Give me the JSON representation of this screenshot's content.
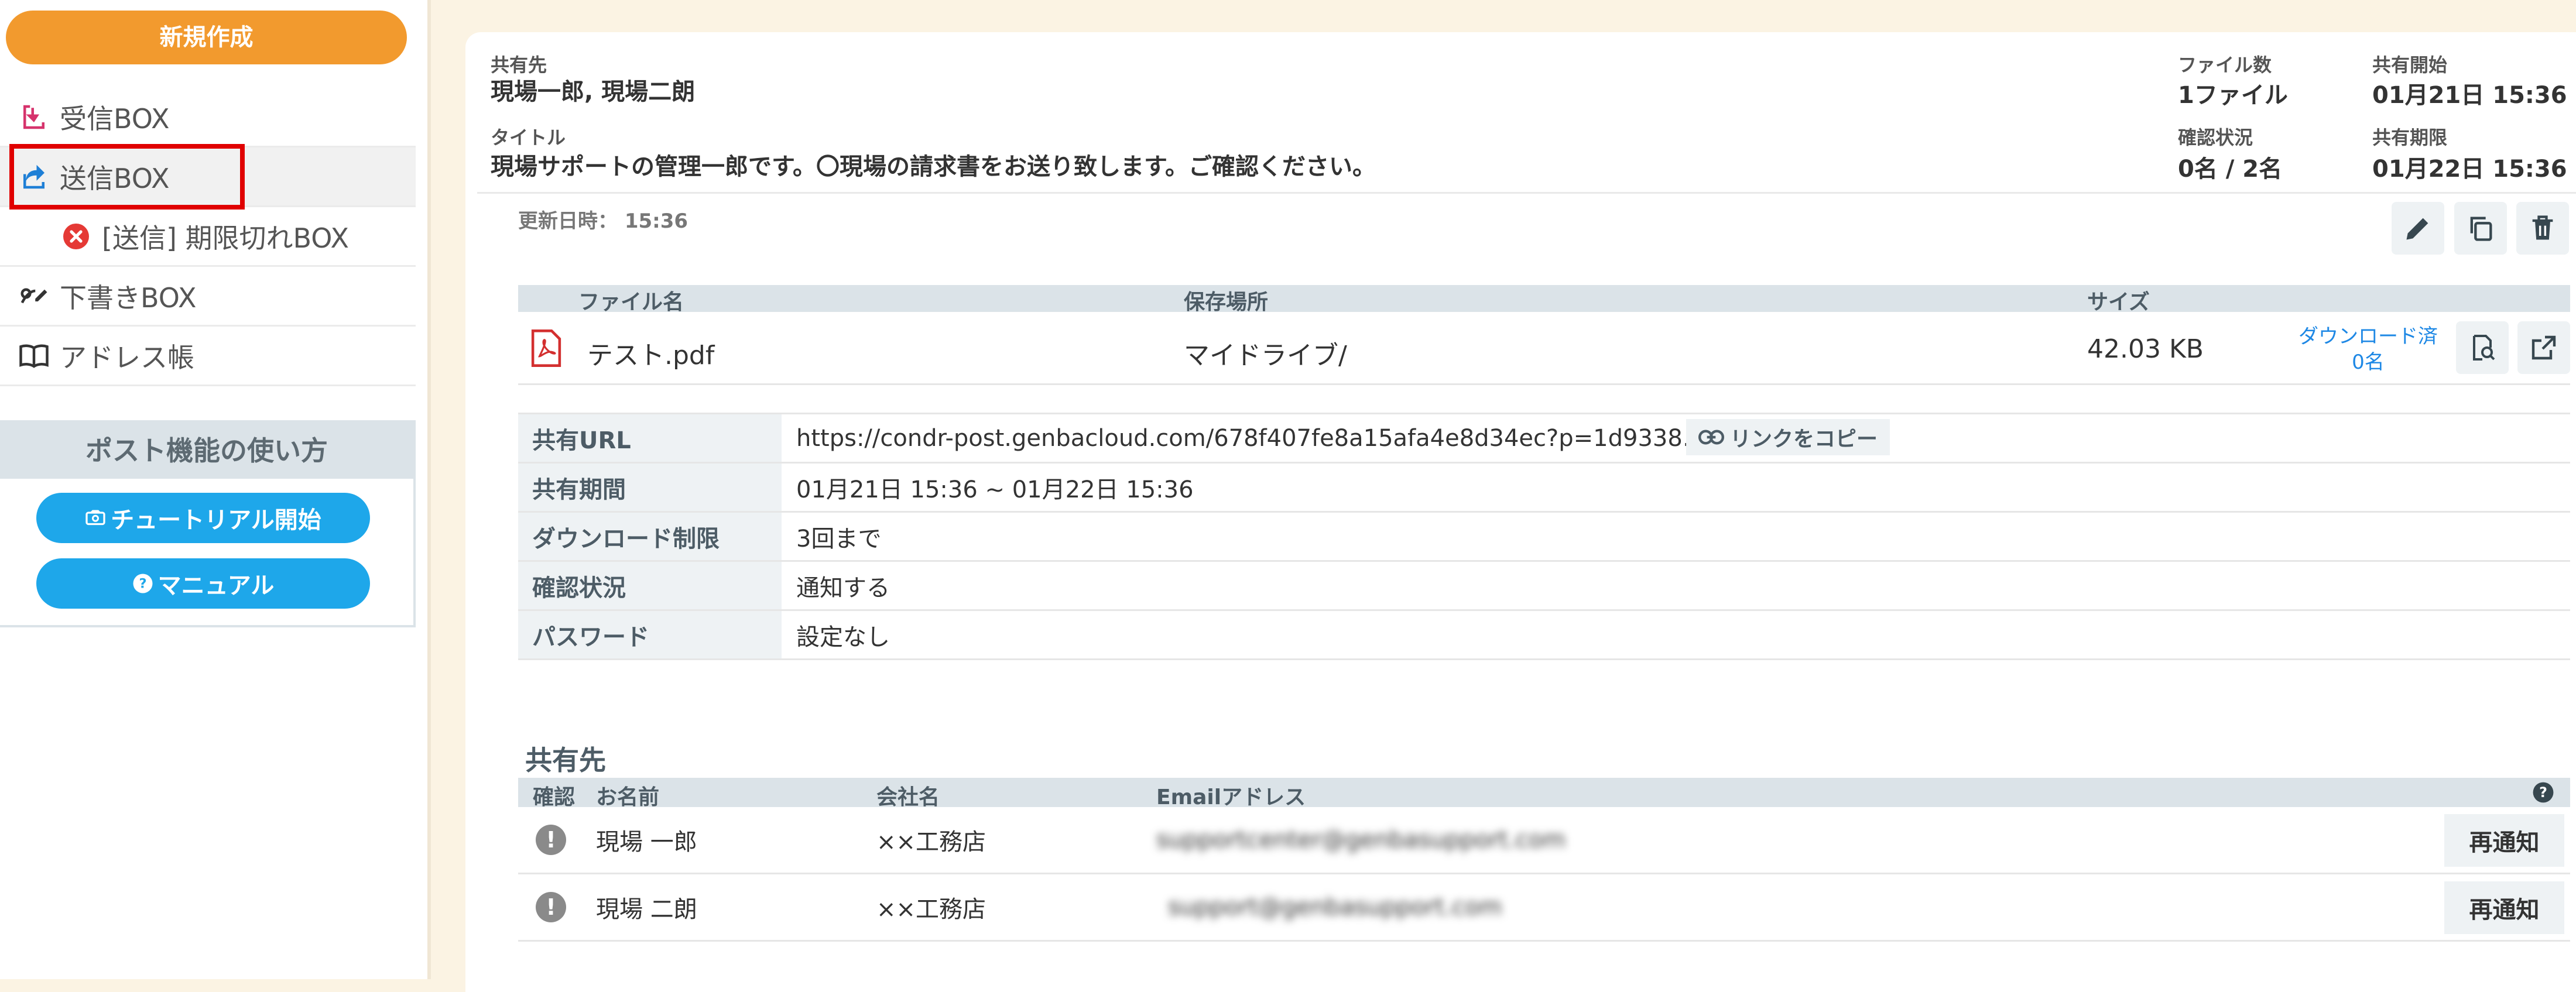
{
  "sidebar": {
    "new_button": "新規作成",
    "items": [
      {
        "label": "受信BOX",
        "icon": "inbox-icon"
      },
      {
        "label": "送信BOX",
        "icon": "send-icon"
      },
      {
        "label": "[送信] 期限切れBOX",
        "icon": "x-circle-icon"
      },
      {
        "label": "下書きBOX",
        "icon": "draft-icon"
      },
      {
        "label": "アドレス帳",
        "icon": "book-icon"
      }
    ],
    "howto": {
      "title": "ポスト機能の使い方",
      "tutorial_button": "チュートリアル開始",
      "manual_button": "マニュアル"
    }
  },
  "header": {
    "share_to_label": "共有先",
    "share_to_value": "現場一郎, 現場二朗",
    "title_label": "タイトル",
    "title_value": "現場サポートの管理一郎です。〇現場の請求書をお送り致します。ご確認ください。",
    "file_count_label": "ファイル数",
    "file_count_value": "1ファイル",
    "share_start_label": "共有開始",
    "share_start_value": "01月21日 15:36",
    "confirm_status_label": "確認状況",
    "confirm_status_value": "0名 / 2名",
    "share_end_label": "共有期限",
    "share_end_value": "01月22日 15:36"
  },
  "updated": {
    "label": "更新日時：",
    "value": "15:36"
  },
  "files": {
    "columns": [
      "ファイル名",
      "保存場所",
      "サイズ"
    ],
    "rows": [
      {
        "name": "テスト.pdf",
        "location": "マイドライブ/",
        "size": "42.03 KB",
        "download_label": "ダウンロード済",
        "download_count": "0名"
      }
    ]
  },
  "info": {
    "url_label": "共有URL",
    "url_value": "https://condr-post.genbacloud.com/678f407fe8a15afa4e8d34ec?p=1d9338…",
    "copy_button": "リンクをコピー",
    "period_label": "共有期間",
    "period_value": "01月21日 15:36 ~ 01月22日 15:36",
    "limit_label": "ダウンロード制限",
    "limit_value": "3回まで",
    "confirm_label": "確認状況",
    "confirm_value": "通知する",
    "password_label": "パスワード",
    "password_value": "設定なし"
  },
  "recipients": {
    "title": "共有先",
    "columns": [
      "確認",
      "お名前",
      "会社名",
      "Emailアドレス"
    ],
    "rows": [
      {
        "name": "現場 一郎",
        "company": "××工務店",
        "email": "supportcenter@genbasupport.com",
        "button": "再通知"
      },
      {
        "name": "現場 二朗",
        "company": "××工務店",
        "email": "support@genbasupport.com",
        "button": "再通知"
      }
    ]
  },
  "colors": {
    "accent_orange": "#f29a2e",
    "accent_blue": "#1ea7ea",
    "highlight_red": "#e00000",
    "header_gray": "#dbe3e8"
  }
}
